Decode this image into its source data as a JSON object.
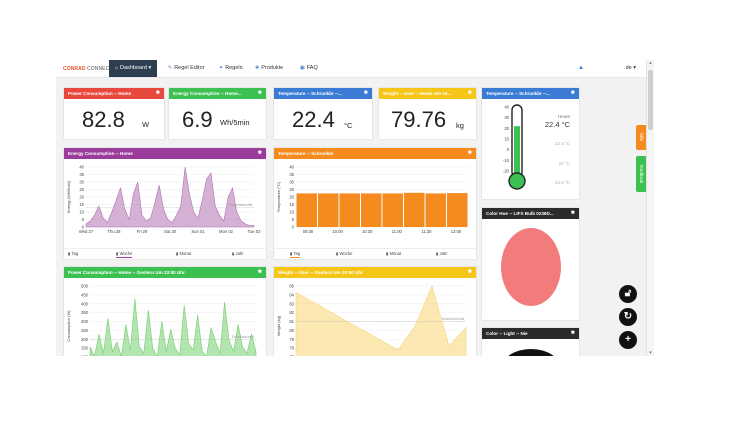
{
  "brand": {
    "name1": "CONRAD",
    "name2": "CONNECT"
  },
  "nav": {
    "dashboard": "Dashboard",
    "regel_editor": "Regel Editor",
    "regeln": "Regeln",
    "produkte": "Produkte",
    "faq": "FAQ",
    "lang": ".de"
  },
  "side_tabs": {
    "hilfe": "hilfe",
    "feedback": "feedback"
  },
  "colors": {
    "red": "#e8483e",
    "green": "#3cc051",
    "blue": "#3a7bd5",
    "yellow": "#f5c518",
    "purple": "#9b3b9b",
    "orange": "#f58a1f",
    "dark": "#2b2b2b"
  },
  "tiles": [
    {
      "title": "Power Consumption -- Home",
      "value": "82.8",
      "unit": "W"
    },
    {
      "title": "Energy Consumption -- Home...",
      "value": "6.9",
      "unit": "Wh/5min"
    },
    {
      "title": "Temperature -- Schrankbr --...",
      "value": "22.4",
      "unit": "°C"
    },
    {
      "title": "Weight -- User -- Heute Um 10...",
      "value": "79.76",
      "unit": "kg"
    }
  ],
  "thermo": {
    "title": "Temperature -- Schrankbr --...",
    "heute_label": "Heute",
    "heute_value": "22.4 °C",
    "entries": [
      "22.4 °C",
      "22 °C",
      "22.4 °C"
    ],
    "scale": [
      "40",
      "30",
      "20",
      "10",
      "0",
      "-10",
      "-20"
    ],
    "fill_fraction": 0.7
  },
  "hue": {
    "title": "Color Hue -- LIFX Bulb 0236D...",
    "color": "#f27c7c"
  },
  "light": {
    "title": "Color -- Light -- Nie"
  },
  "energy": {
    "title": "Energy Consumption -- Home",
    "avg_label": "Durchschnitt",
    "tabs": [
      "Tag",
      "Woche",
      "Monat",
      "Jahr"
    ]
  },
  "temp": {
    "title": "Temperature -- Schrankbr",
    "tabs": [
      "Tag",
      "Woche",
      "Monat",
      "Jahr"
    ]
  },
  "power": {
    "title": "Power Consumption -- Home -- Gestern Um 23:00 Uhr",
    "avg_label": "Durchschnitt"
  },
  "weight": {
    "title": "Weight -- User -- Gestern Um 20:00 Uhr",
    "avg_label": "Durchschnitt"
  },
  "chart_data": [
    {
      "type": "area",
      "title": "Energy Consumption -- Home",
      "ylabel": "Energy (Wh/5min)",
      "ylim": [
        0,
        40
      ],
      "yticks": [
        "40",
        "35",
        "30",
        "25",
        "20",
        "15",
        "10",
        "5",
        "0"
      ],
      "x_labels": [
        "Wed 27",
        "Thu 28",
        "Fri 29",
        "Sat 30",
        "Sun 01",
        "Mon 02",
        "Tue 03"
      ],
      "values": [
        2,
        4,
        8,
        14,
        6,
        3,
        10,
        18,
        26,
        12,
        5,
        22,
        30,
        8,
        4,
        6,
        16,
        28,
        12,
        5,
        3,
        8,
        14,
        40,
        22,
        10,
        6,
        18,
        32,
        36,
        14,
        8,
        4,
        20,
        26,
        10,
        4,
        2,
        1,
        1
      ],
      "color": "#b071b3"
    },
    {
      "type": "bar",
      "title": "Temperature -- Schrankbr",
      "ylabel": "Temperature (°C)",
      "ylim": [
        0,
        40
      ],
      "yticks": [
        "40",
        "35",
        "30",
        "25",
        "20",
        "15",
        "10",
        "5",
        "0"
      ],
      "categories": [
        "09:30",
        "10:00",
        "10:30",
        "11:00",
        "11:30",
        "12:00"
      ],
      "values": [
        22.4,
        22.4,
        22.4,
        22.4,
        22.4,
        22.8,
        22.4,
        22.6
      ],
      "color": "#f58a1f"
    },
    {
      "type": "area",
      "title": "Power Consumption -- Home -- Gestern Um 23:00 Uhr",
      "ylabel": "Consumption (W)",
      "ylim": [
        0,
        500
      ],
      "yticks": [
        "500",
        "450",
        "400",
        "350",
        "300",
        "250",
        "200",
        "150",
        "100",
        "50"
      ],
      "values": [
        120,
        60,
        200,
        80,
        300,
        90,
        150,
        60,
        260,
        100,
        420,
        120,
        80,
        350,
        110,
        60,
        280,
        90,
        230,
        110,
        70,
        380,
        140,
        100,
        320,
        90,
        60,
        240,
        150,
        80,
        400,
        160,
        90,
        260,
        120,
        80,
        200,
        90
      ],
      "color": "#75cf6f"
    },
    {
      "type": "area",
      "title": "Weight -- User -- Gestern Um 20:00 Uhr",
      "ylabel": "Weight (kg)",
      "ylim": [
        75,
        85
      ],
      "yticks": [
        "85",
        "84",
        "83",
        "82",
        "81",
        "80",
        "79",
        "78",
        "77",
        "76"
      ],
      "values": [
        84.2,
        83.0,
        81.8,
        80.6,
        79.4,
        78.2,
        77.0,
        80.0,
        85.0,
        77.5,
        79.8
      ],
      "color": "#f7d674"
    }
  ]
}
